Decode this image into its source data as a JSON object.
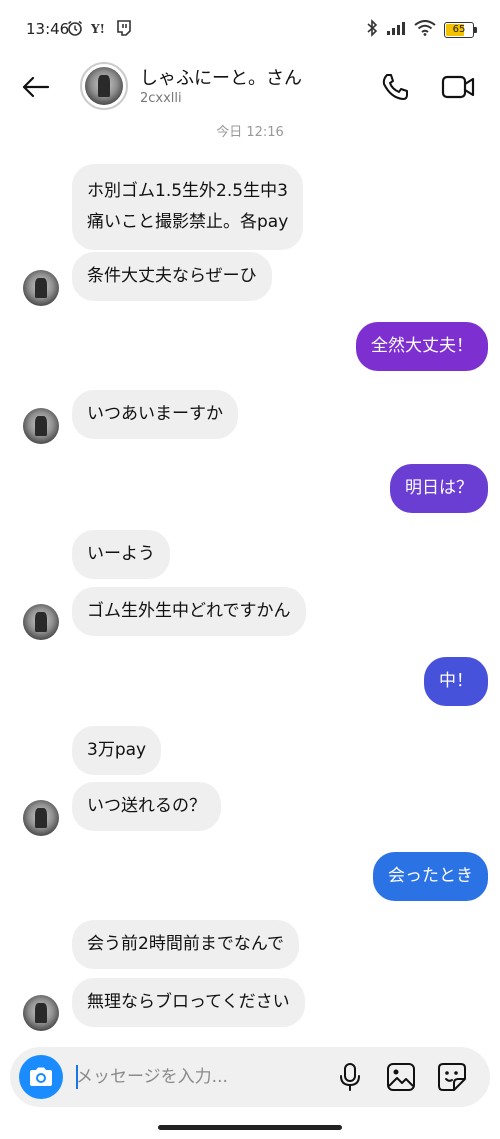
{
  "status_bar": {
    "time": "13:46",
    "battery": "65",
    "battery_level": 0.65,
    "icons_left": [
      "alarm-icon",
      "yahoo-icon",
      "app-notification-icon"
    ],
    "icons_right": [
      "bluetooth-icon",
      "signal-icon",
      "wifi-icon",
      "battery-icon"
    ]
  },
  "header": {
    "name": "しゃふにーと。さん",
    "username": "2cxxlli",
    "icons": [
      "back-arrow-icon",
      "phone-icon",
      "video-icon"
    ]
  },
  "timestamp": "今日 12:16",
  "messages": [
    {
      "direction": "in",
      "text": "ホ別ゴム1.5生外2.5生中3\n痛いこと撮影禁止。各pay"
    },
    {
      "direction": "in",
      "text": "条件大丈夫ならぜーひ"
    },
    {
      "direction": "out",
      "text": "全然大丈夫！",
      "color": "#7e2fd0"
    },
    {
      "direction": "in",
      "text": "いつあいまーすか"
    },
    {
      "direction": "out",
      "text": "明日は？",
      "color": "#6a3dd3"
    },
    {
      "direction": "in",
      "text": "いーよう"
    },
    {
      "direction": "in",
      "text": "ゴム生外生中どれですかん"
    },
    {
      "direction": "out",
      "text": "中！",
      "color": "#4652d9"
    },
    {
      "direction": "in",
      "text": "3万pay"
    },
    {
      "direction": "in",
      "text": "いつ送れるの？"
    },
    {
      "direction": "out",
      "text": "会ったとき",
      "color": "#2b72e4"
    },
    {
      "direction": "in",
      "text": "会う前2時間前までなんで"
    },
    {
      "direction": "in",
      "text": "無理ならブロってください"
    }
  ],
  "composer": {
    "placeholder": "メッセージを入力...",
    "value": "",
    "icons": [
      "camera-icon",
      "microphone-icon",
      "gallery-icon",
      "sticker-icon"
    ],
    "accent": "#1a8cff"
  }
}
